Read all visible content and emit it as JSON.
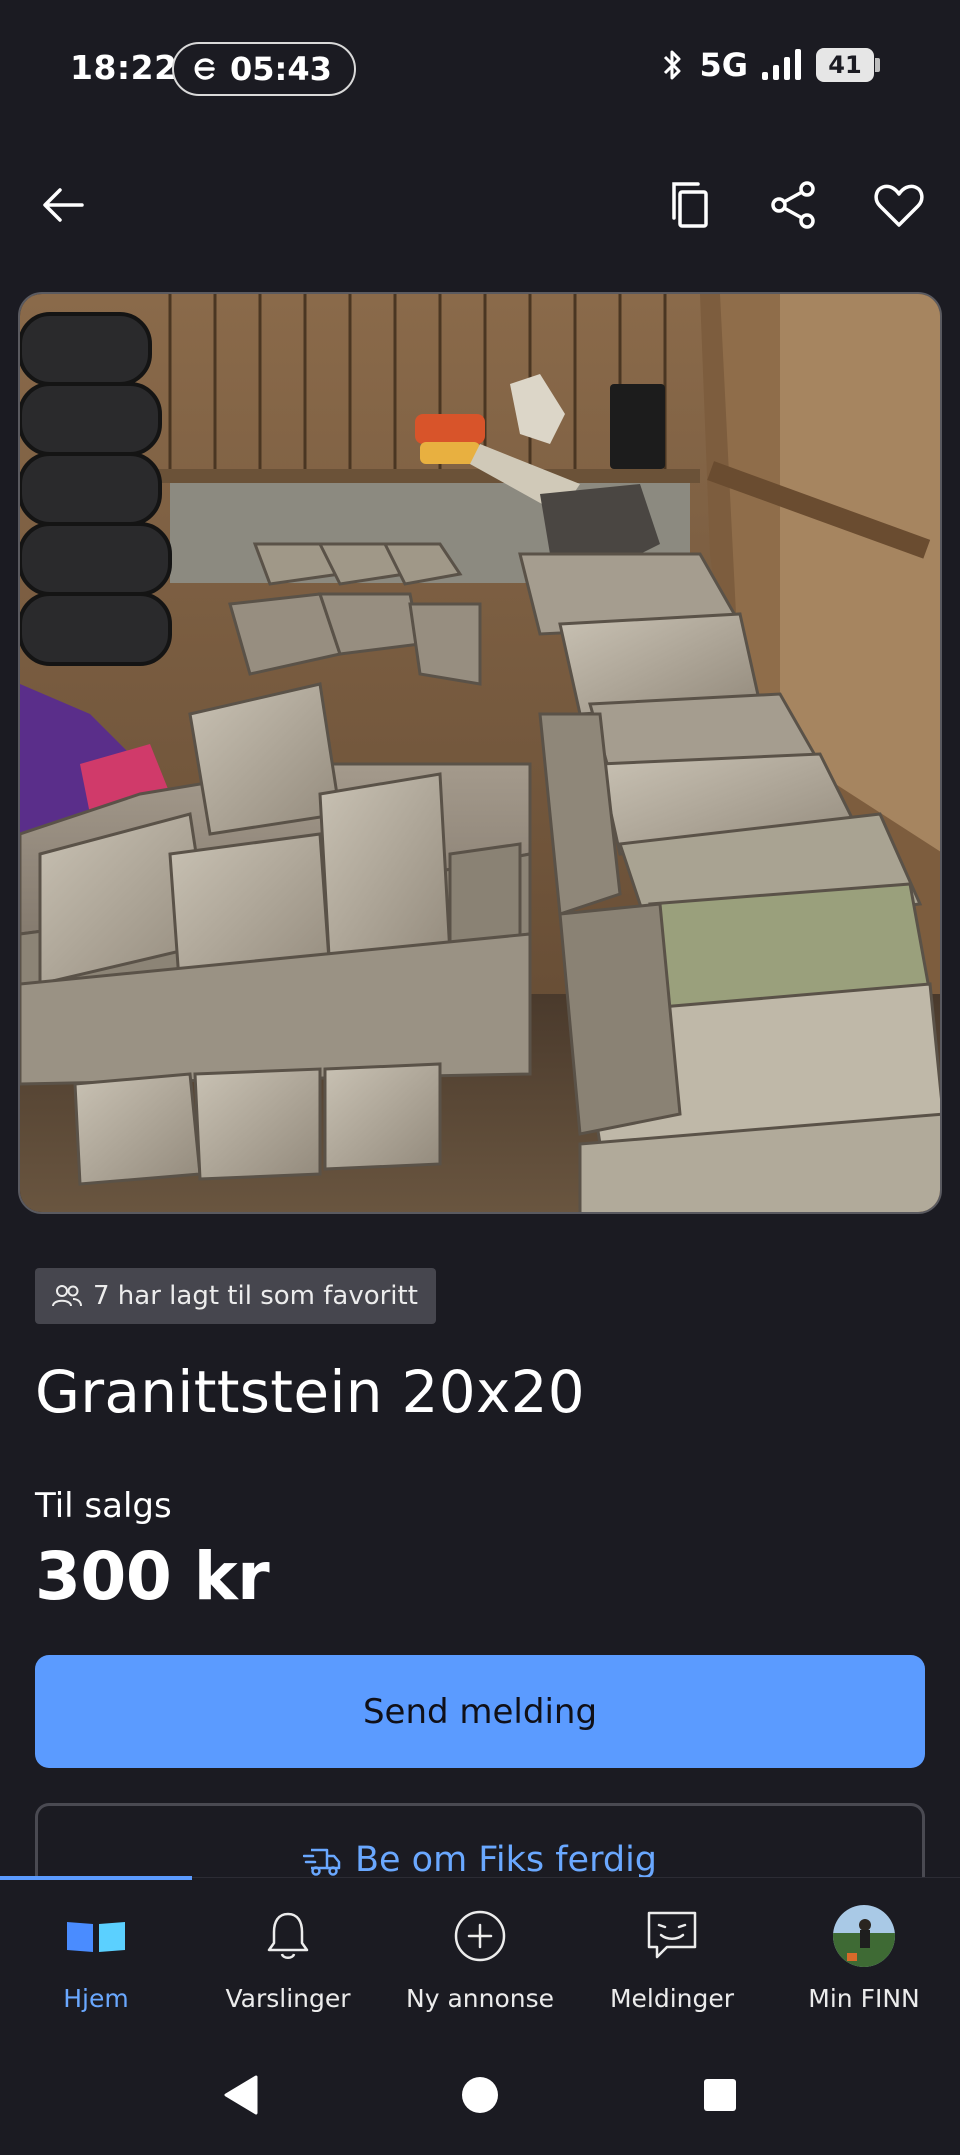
{
  "status_bar": {
    "time": "18:22",
    "pill_time": "05:43",
    "network": "5G",
    "battery": "41"
  },
  "top_nav": {
    "icons": [
      "arrow-left-icon",
      "copy-icon",
      "share-icon",
      "heart-icon"
    ]
  },
  "listing": {
    "favorite_count_text": "7 har lagt til som favoritt",
    "title": "Granittstein 20x20",
    "sale_type": "Til salgs",
    "price": "300 kr"
  },
  "actions": {
    "send_message": "Send melding",
    "fiks_ferdig": "Be om Fiks ferdig"
  },
  "tabs": [
    {
      "label": "Hjem",
      "icon": "book-icon",
      "active": true
    },
    {
      "label": "Varslinger",
      "icon": "bell-icon",
      "active": false
    },
    {
      "label": "Ny annonse",
      "icon": "plus-circle-icon",
      "active": false
    },
    {
      "label": "Meldinger",
      "icon": "chat-icon",
      "active": false
    },
    {
      "label": "Min FINN",
      "icon": "avatar",
      "active": false
    }
  ],
  "colors": {
    "background": "#1b1b22",
    "accent": "#5b9bff",
    "link": "#6aa8ff"
  }
}
